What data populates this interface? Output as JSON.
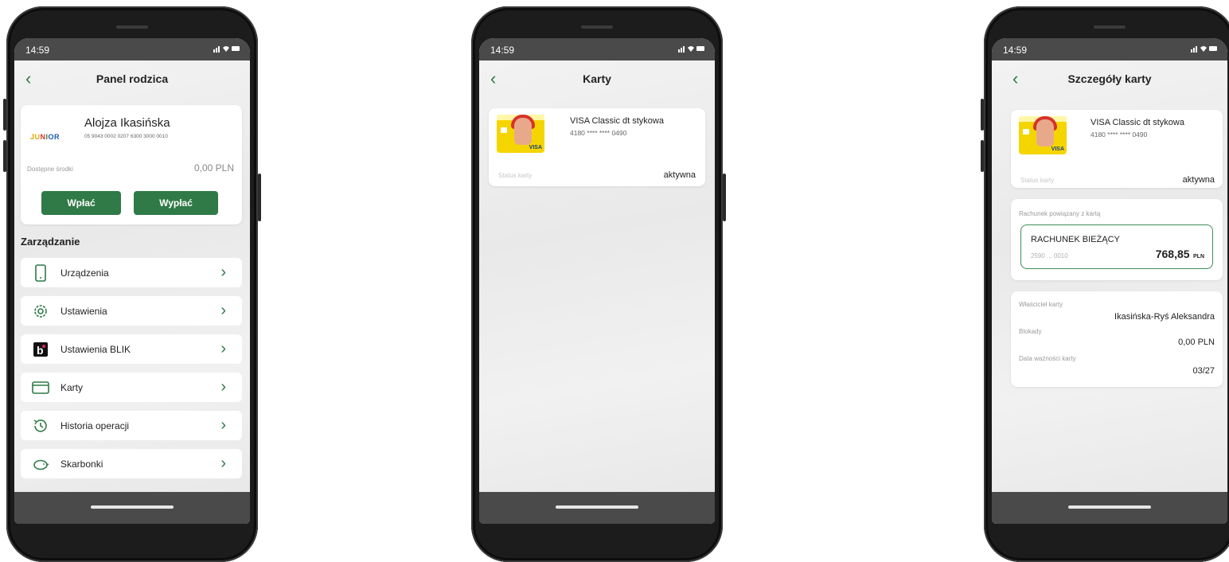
{
  "status_bar": {
    "time": "14:59",
    "indicators": "signal-icon wifi-icon battery-icon"
  },
  "screens": {
    "panel": {
      "title": "Panel rodzica",
      "account": {
        "name": "Alojza Ikasińska",
        "number": "05 9043 0002 0207 6300 3000 0010",
        "logo_text": "JUNIOR",
        "available_label": "Dostępne środki",
        "available_value": "0,00 PLN"
      },
      "buttons": {
        "deposit": "Wpłać",
        "withdraw": "Wypłać"
      },
      "section_title": "Zarządzanie",
      "menu": [
        {
          "label": "Urządzenia",
          "icon": "phone-icon"
        },
        {
          "label": "Ustawienia",
          "icon": "gear-icon"
        },
        {
          "label": "Ustawienia BLIK",
          "icon": "blik-icon"
        },
        {
          "label": "Karty",
          "icon": "card-icon"
        },
        {
          "label": "Historia operacji",
          "icon": "history-icon"
        },
        {
          "label": "Skarbonki",
          "icon": "piggy-bank-icon"
        }
      ]
    },
    "cards": {
      "title": "Karty",
      "card": {
        "name": "VISA Classic dt stykowa",
        "number": "4180 **** **** 0490",
        "status_label": "Status karty",
        "status_value": "aktywna"
      }
    },
    "card_details": {
      "title": "Szczegóły karty",
      "card": {
        "name": "VISA Classic dt stykowa",
        "number": "4180 **** **** 0490",
        "status_label": "Status karty",
        "status_value": "aktywna"
      },
      "linked_account": {
        "label": "Rachunek powiązany z kartą",
        "name": "RACHUNEK BIEŻĄCY",
        "number": "2590 ... 0010",
        "amount": "768,85",
        "currency": "PLN"
      },
      "details": {
        "owner_label": "Właściciel karty",
        "owner_value": "Ikasińska-Ryś Aleksandra",
        "blocks_label": "Blokady",
        "blocks_value": "0,00 PLN",
        "expiry_label": "Data ważności karty",
        "expiry_value": "03/27"
      }
    }
  },
  "colors": {
    "accent": "#2f7a46",
    "frame": "#1c1c1c",
    "screen_bg": "#eeeeee"
  }
}
